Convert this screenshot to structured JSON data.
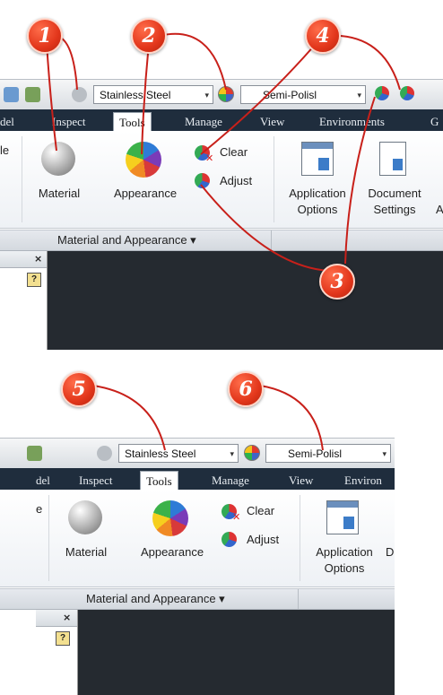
{
  "callouts": [
    "1",
    "2",
    "3",
    "4",
    "5",
    "6"
  ],
  "qat": {
    "material_value": "Stainless Steel",
    "appearance_value": "Semi-Polisl",
    "dropdown_arrow": "▾"
  },
  "tabs": {
    "top": [
      "del",
      "Inspect",
      "Tools",
      "Manage",
      "View",
      "Environments",
      "G"
    ],
    "bottom": [
      "del",
      "Inspect",
      "Tools",
      "Manage",
      "View",
      "Environ"
    ]
  },
  "ribbon": {
    "material_label": "Material",
    "appearance_label": "Appearance",
    "clear_label": "Clear",
    "adjust_label": "Adjust",
    "app_options_line1": "Application",
    "app_options_line2": "Options",
    "doc_settings_line1": "Document",
    "doc_settings_line2": "Settings",
    "group_title": "Material and Appearance ▾",
    "left_frag_1": "le",
    "left_frag_2": "e",
    "truncated_a": "A",
    "truncated_d": "D"
  },
  "pane": {
    "close_glyph": "×",
    "help_glyph": "?"
  },
  "colors": {
    "callout": "#e2361b",
    "leader_line": "#c8201a",
    "tab_bar": "#1f2d3d",
    "canvas": "#252a30"
  },
  "icons": [
    "sphere-material-icon",
    "color-wheel-icon",
    "clear-appearance-icon",
    "adjust-appearance-icon",
    "application-options-icon",
    "document-settings-icon",
    "help-icon",
    "close-icon"
  ]
}
